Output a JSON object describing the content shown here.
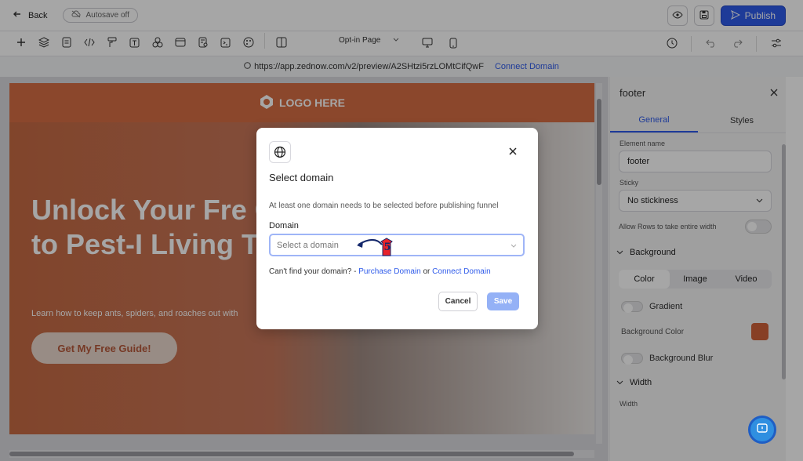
{
  "topbar": {
    "back_label": "Back",
    "autosave_label": "Autosave off",
    "publish_label": "Publish"
  },
  "toolbar": {
    "page_select": "Opt-in Page"
  },
  "urlbar": {
    "url": "https://app.zednow.com/v2/preview/A2SHtzi5rzLOMtCifQwF",
    "connect_label": "Connect Domain"
  },
  "preview": {
    "logo_text": "LOGO HERE",
    "hero_title": "Unlock Your Free Guide to Pest-Free Living Today!",
    "hero_title_visible": "Unlock Your Fre Guide to Pest-I Living Today!",
    "hero_subtitle": "Learn how to keep ants, spiders, and roaches out with",
    "cta_label": "Get My Free Guide!",
    "brand_color": "#d66e44"
  },
  "panel": {
    "title": "footer",
    "tabs": [
      "General",
      "Styles"
    ],
    "element_name_label": "Element name",
    "element_name_value": "footer",
    "sticky_label": "Sticky",
    "sticky_value": "No stickiness",
    "allow_rows_label": "Allow Rows to take entire width",
    "background_section": "Background",
    "bg_tabs": [
      "Color",
      "Image",
      "Video"
    ],
    "gradient_label": "Gradient",
    "bg_color_label": "Background Color",
    "bg_color_value": "#d0623a",
    "bg_blur_label": "Background Blur",
    "width_section": "Width",
    "width_label": "Width"
  },
  "modal": {
    "title": "Select domain",
    "description": "At least one domain needs to be selected before publishing funnel",
    "domain_label": "Domain",
    "domain_placeholder": "Select a domain",
    "help_prefix": "Can't find your domain? -",
    "purchase_link": "Purchase Domain",
    "or_text": "or",
    "connect_link": "Connect Domain",
    "cancel_label": "Cancel",
    "save_label": "Save",
    "step_number": "5"
  },
  "colors": {
    "accent": "#2f5bea",
    "step_marker": "#e8222a"
  }
}
